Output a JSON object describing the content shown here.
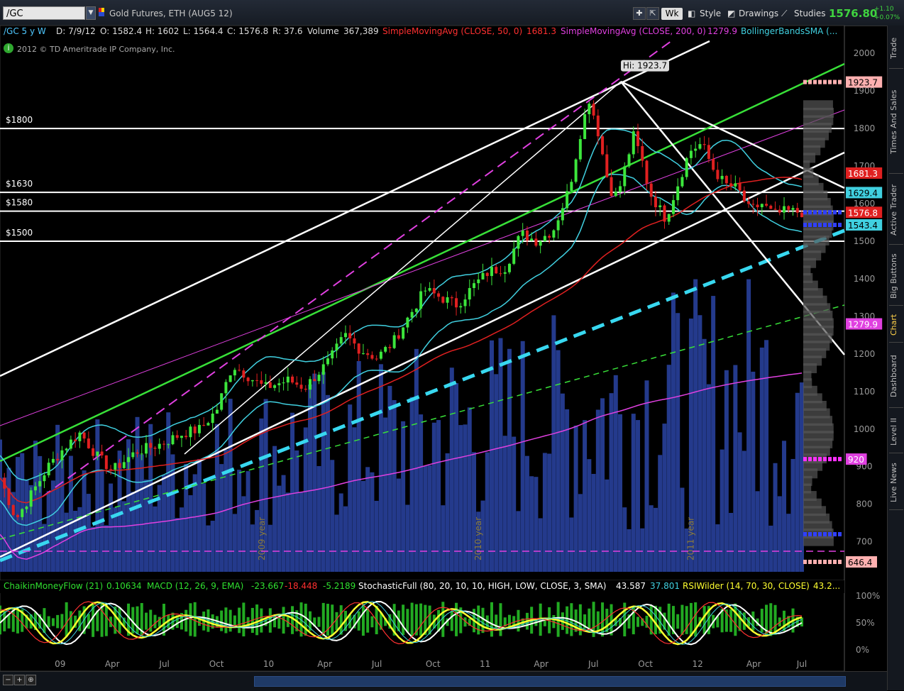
{
  "toolbar": {
    "symbol": "/GC",
    "description": "Gold Futures, ETH (AUG5 12)",
    "period_button": "Wk",
    "style_label": "Style",
    "drawings_label": "Drawings",
    "studies_label": "Studies",
    "last_price": "1576.80",
    "net_change": "+1.10",
    "pct_change": "+0.07%"
  },
  "header": {
    "symbol_period": "/GC 5 y W",
    "date": "D: 7/9/12",
    "open": "O: 1582.4",
    "high": "H: 1602",
    "low": "L: 1564.4",
    "close": "C: 1576.8",
    "range": "R: 37.6",
    "volume_label": "Volume",
    "volume_value": "367,389",
    "sma50_label": "SimpleMovingAvg (CLOSE, 50, 0)",
    "sma50_value": "1681.3",
    "sma200_label": "SimpleMovingAvg (CLOSE, 200, 0)",
    "sma200_value": "1279.9",
    "bb_label": "BollingerBandsSMA (...",
    "copyright": "2012 © TD Ameritrade IP Company, Inc."
  },
  "oscillator_header": {
    "cmf_label": "ChaikinMoneyFlow (21)",
    "cmf_value": "0.10634",
    "macd_label": "MACD (12, 26, 9, EMA)",
    "macd_v1": "-23.667",
    "macd_v2": "-18.448",
    "macd_v3": "-5.2189",
    "stoch_label": "StochasticFull (80, 20, 10, 10, HIGH, LOW, CLOSE, 3, SMA)",
    "stoch_v1": "43.587",
    "stoch_v2": "37.801",
    "rsi_label": "RSIWilder (14, 70, 30, CLOSE)",
    "rsi_value": "43.2..."
  },
  "side_tabs": [
    "Trade",
    "Times And Sales",
    "Active Trader",
    "Big Buttons",
    "Chart",
    "Dashboard",
    "Level II",
    "Live News"
  ],
  "colors": {
    "up_candle": "#3ce63c",
    "down_candle": "#e02020",
    "volume": "#243a8c",
    "sma50": "#e02020",
    "sma200": "#e040e0",
    "bollinger": "#40d0e0",
    "trendline_green": "#38e038",
    "trendline_cyan": "#38d8f0"
  },
  "chart_data": {
    "type": "candlestick",
    "title": "Gold Futures, ETH (AUG5 12)",
    "period": "weekly, 5 years",
    "ylim": [
      620,
      2040
    ],
    "y_ticks": [
      700,
      800,
      900,
      1000,
      1100,
      1200,
      1300,
      1400,
      1500,
      1600,
      1700,
      1800,
      1900,
      2000
    ],
    "x_ticks": [
      "09",
      "Apr",
      "Jul",
      "Oct",
      "10",
      "Apr",
      "Jul",
      "Oct",
      "11",
      "Apr",
      "Jul",
      "Oct",
      "12",
      "Apr",
      "Jul"
    ],
    "year_markers": [
      "2009 year",
      "2010 year",
      "2011 year"
    ],
    "horizontal_levels": [
      {
        "label": "$1800",
        "value": 1800
      },
      {
        "label": "$1630",
        "value": 1630
      },
      {
        "label": "$1580",
        "value": 1580
      },
      {
        "label": "$1500",
        "value": 1500
      }
    ],
    "high_annotation": "Hi: 1923.7",
    "price_bubbles": [
      {
        "value": 1923.7,
        "text": "1923.7",
        "color": "#ffb0b0"
      },
      {
        "value": 1681.3,
        "text": "1681.3",
        "color": "#e02020"
      },
      {
        "value": 1629.4,
        "text": "1629.4",
        "color": "#40d0e0"
      },
      {
        "value": 1576.8,
        "text": "1576.8",
        "color": "#e02020"
      },
      {
        "value": 1543.4,
        "text": "1543.4",
        "color": "#40d0e0"
      },
      {
        "value": 1279.9,
        "text": "1279.9",
        "color": "#e040e0"
      },
      {
        "value": 920,
        "text": "920",
        "color": "#e040e0"
      },
      {
        "value": 646.4,
        "text": "646.4",
        "color": "#ffb0b0"
      }
    ],
    "close_path": [
      [
        0,
        870
      ],
      [
        0.02,
        760
      ],
      [
        0.04,
        830
      ],
      [
        0.06,
        900
      ],
      [
        0.08,
        950
      ],
      [
        0.1,
        990
      ],
      [
        0.12,
        930
      ],
      [
        0.14,
        890
      ],
      [
        0.17,
        940
      ],
      [
        0.2,
        960
      ],
      [
        0.23,
        990
      ],
      [
        0.25,
        1000
      ],
      [
        0.27,
        1050
      ],
      [
        0.29,
        1170
      ],
      [
        0.31,
        1140
      ],
      [
        0.33,
        1110
      ],
      [
        0.36,
        1130
      ],
      [
        0.38,
        1110
      ],
      [
        0.41,
        1180
      ],
      [
        0.43,
        1250
      ],
      [
        0.45,
        1210
      ],
      [
        0.47,
        1190
      ],
      [
        0.49,
        1230
      ],
      [
        0.51,
        1300
      ],
      [
        0.53,
        1370
      ],
      [
        0.55,
        1350
      ],
      [
        0.57,
        1330
      ],
      [
        0.59,
        1380
      ],
      [
        0.61,
        1420
      ],
      [
        0.63,
        1430
      ],
      [
        0.65,
        1520
      ],
      [
        0.67,
        1500
      ],
      [
        0.69,
        1530
      ],
      [
        0.71,
        1640
      ],
      [
        0.725,
        1800
      ],
      [
        0.735,
        1880
      ],
      [
        0.745,
        1800
      ],
      [
        0.76,
        1640
      ],
      [
        0.77,
        1620
      ],
      [
        0.79,
        1780
      ],
      [
        0.8,
        1720
      ],
      [
        0.81,
        1630
      ],
      [
        0.83,
        1560
      ],
      [
        0.845,
        1650
      ],
      [
        0.86,
        1740
      ],
      [
        0.875,
        1760
      ],
      [
        0.89,
        1690
      ],
      [
        0.905,
        1650
      ],
      [
        0.92,
        1640
      ],
      [
        0.935,
        1580
      ],
      [
        0.95,
        1600
      ],
      [
        0.965,
        1570
      ],
      [
        0.98,
        1580
      ],
      [
        1.0,
        1576.8
      ]
    ],
    "oscillator_ylim": [
      0,
      100
    ],
    "oscillator_ticks": [
      "0%",
      "50%",
      "100%"
    ]
  }
}
